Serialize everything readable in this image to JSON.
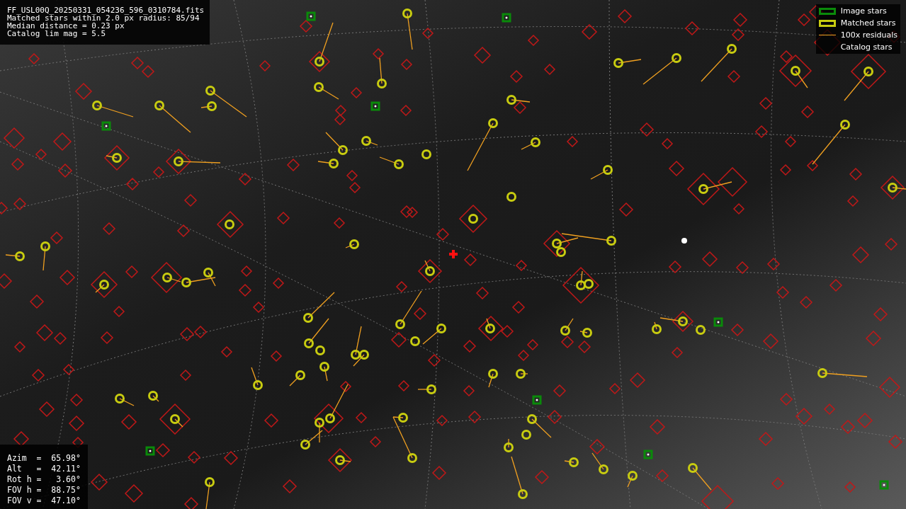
{
  "info": {
    "lines": [
      "FF_USL00Q_20250331_054236_596_0310784.fits",
      "Matched stars within 2.0 px radius: 85/94",
      "Median distance = 0.23 px",
      "Catalog lim mag = 5.5"
    ]
  },
  "legend": [
    {
      "kind": "image",
      "label": "Image stars"
    },
    {
      "kind": "matched",
      "label": "Matched stars"
    },
    {
      "kind": "residual",
      "label": "100x residuals"
    },
    {
      "kind": "catalog",
      "label": "Catalog stars"
    }
  ],
  "pointing": {
    "lines": [
      "Azim  =  65.98°",
      "Alt   =  42.11°",
      "Rot h =   3.60°",
      "FOV h =  88.75°",
      "FOV v =  47.10°"
    ]
  }
}
